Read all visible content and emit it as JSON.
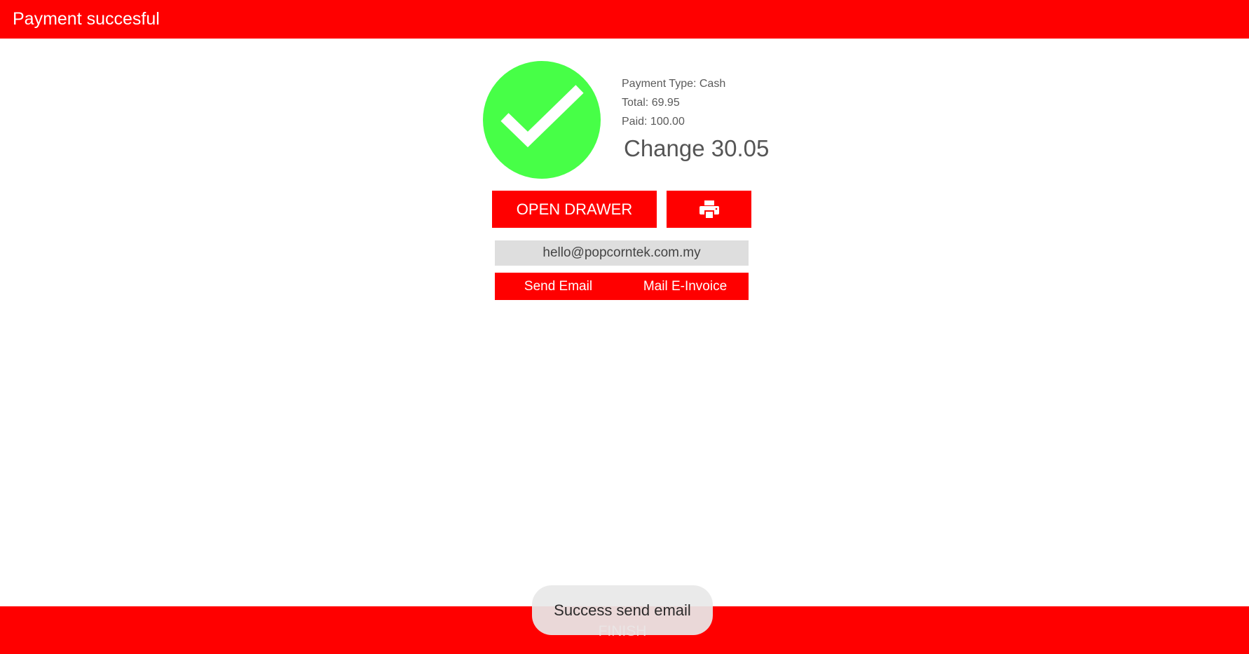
{
  "header": {
    "title": "Payment succesful",
    "background": "#ff0000"
  },
  "status": {
    "icon": "check-icon",
    "color": "#47ff47"
  },
  "payment": {
    "type_line": "Payment Type: Cash",
    "total_line": "Total: 69.95",
    "paid_line": "Paid: 100.00",
    "change_line": "Change 30.05"
  },
  "actions": {
    "open_drawer_label": "OPEN DRAWER",
    "print_icon": "printer-icon"
  },
  "email": {
    "value": "hello@popcorntek.com.my",
    "send_label": "Send Email",
    "invoice_label": "Mail E-Invoice"
  },
  "footer": {
    "finish_label": "FINISH"
  },
  "toast": {
    "message": "Success send email"
  },
  "colors": {
    "accent": "#ff0000",
    "success": "#47ff47",
    "field": "#dedede"
  }
}
